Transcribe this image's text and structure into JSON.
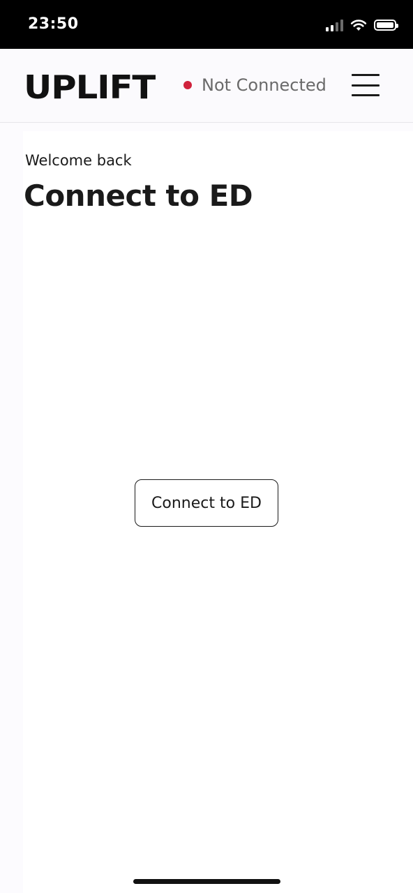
{
  "status_bar": {
    "time": "23:50",
    "icons": [
      "signal-icon",
      "wifi-icon",
      "battery-icon"
    ]
  },
  "header": {
    "logo": "UPLIFT",
    "connection_status": "Not Connected",
    "status_color": "#d0223c",
    "menu_icon": "hamburger-menu-icon"
  },
  "main": {
    "welcome": "Welcome back",
    "title": "Connect to ED",
    "connect_button_label": "Connect to ED"
  }
}
